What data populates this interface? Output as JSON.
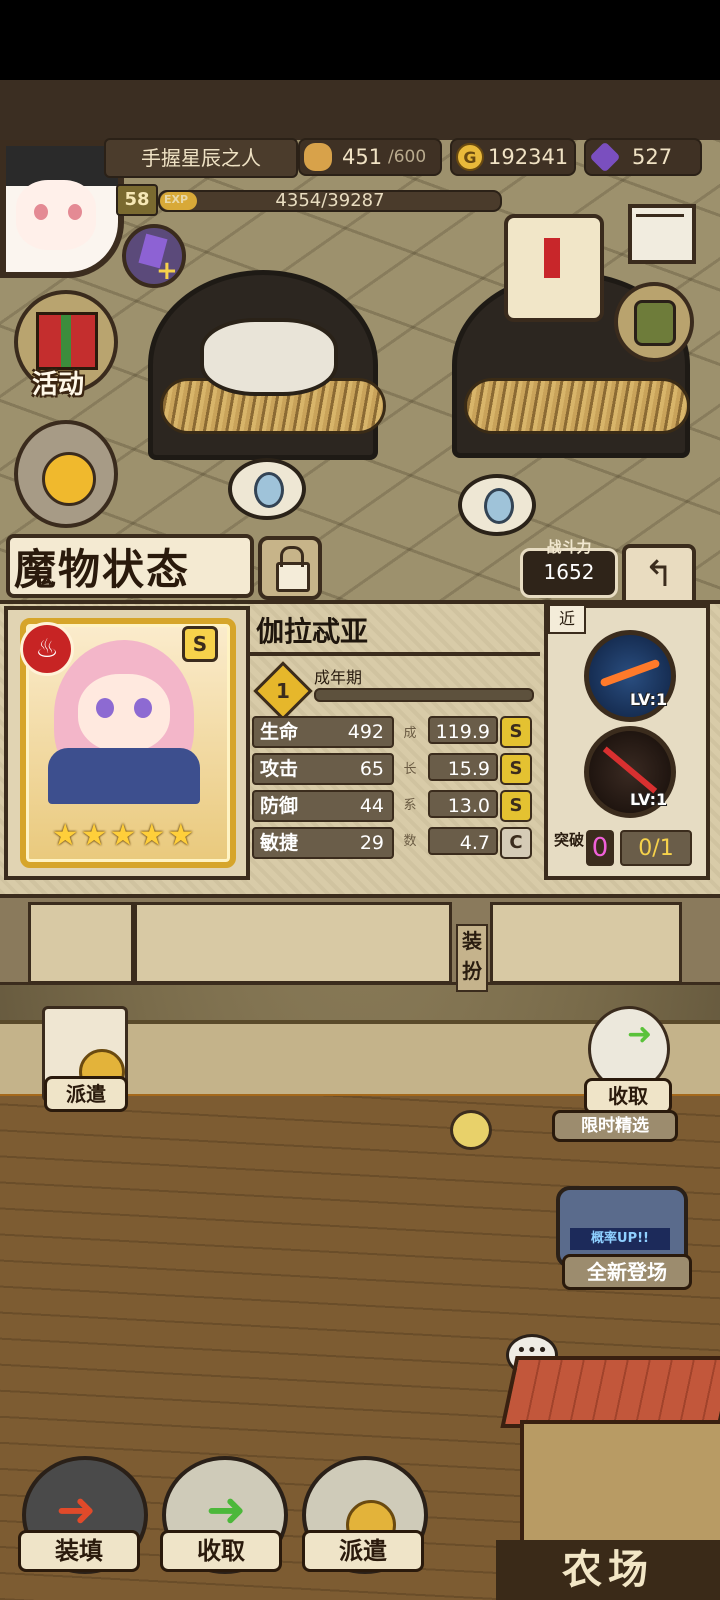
{
  "player": {
    "name": "手握星辰之人",
    "level": "58",
    "exp_label": "EXP",
    "exp_value": "4354/39287",
    "exp_progress": 0.11
  },
  "resources": {
    "stamina": "451",
    "stamina_max": "/600",
    "gold": "192341",
    "gems": "527"
  },
  "side_menu": {
    "activity": "活动"
  },
  "panel": {
    "title": "魔物状态",
    "power_label": "战斗力",
    "power_value": "1652",
    "monster_name": "伽拉忒亚",
    "stage_number": "1",
    "stage_name": "成年期",
    "grade": "S",
    "stars": "★★★★★",
    "stats": [
      {
        "label": "生命",
        "value": "492",
        "growth": "119.9",
        "grade": "S"
      },
      {
        "label": "攻击",
        "value": "65",
        "growth": "15.9",
        "grade": "S"
      },
      {
        "label": "防御",
        "value": "44",
        "growth": "13.0",
        "grade": "S"
      },
      {
        "label": "敏捷",
        "value": "29",
        "growth": "4.7",
        "grade": "C"
      }
    ],
    "growth_title": [
      "成",
      "长",
      "系",
      "数"
    ],
    "range_label": "近",
    "skills": [
      {
        "level": "LV:1"
      },
      {
        "level": "LV:1"
      }
    ],
    "breakthrough_label": "突破",
    "breakthrough_count": "0",
    "breakthrough_progress": "0/1",
    "equip_tab": "装扮"
  },
  "farm_actions": {
    "dispatch": "派遣",
    "collect": "收取",
    "limited": "限时精选",
    "new_arrival": "全新登场",
    "prob_up": "概率UP!!"
  },
  "bottom_bar": {
    "load": "装填",
    "collect": "收取",
    "dispatch": "派遣",
    "farm": "农场"
  }
}
